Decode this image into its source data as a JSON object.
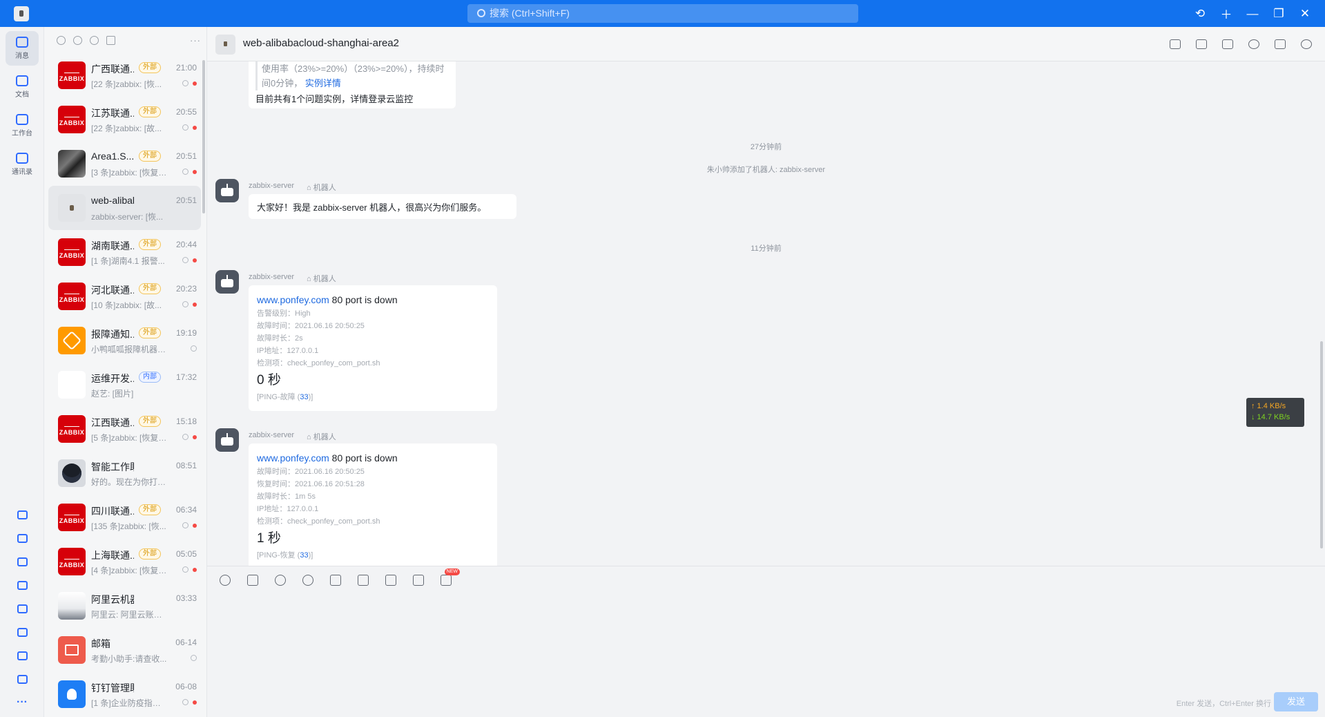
{
  "topbar": {
    "search_placeholder": "搜索 (Ctrl+Shift+F)"
  },
  "rail": {
    "items": [
      {
        "label": "消息",
        "icon": "chat-icon"
      },
      {
        "label": "文档",
        "icon": "doc-icon"
      },
      {
        "label": "工作台",
        "icon": "apps-icon"
      },
      {
        "label": "通讯录",
        "icon": "contacts-icon"
      }
    ]
  },
  "list": {
    "conversations": [
      {
        "name": "广西联通...",
        "tag": "外部",
        "time": "21:00",
        "preview": "[22 条]zabbix: [恢...",
        "avatar": "zabbix"
      },
      {
        "name": "江苏联通...",
        "tag": "外部",
        "time": "20:55",
        "preview": "[22 条]zabbix: [故...",
        "avatar": "zabbix"
      },
      {
        "name": "Area1.S...",
        "tag": "外部",
        "time": "20:51",
        "preview": "[3 条]zabbix: [恢复]...",
        "avatar": "photo"
      },
      {
        "name": "web-alibaba...",
        "tag": "",
        "time": "20:51",
        "preview": "zabbix-server: [恢...",
        "avatar": "light"
      },
      {
        "name": "湖南联通...",
        "tag": "外部",
        "time": "20:44",
        "preview": "[1 条]湖南4.1 报警...",
        "avatar": "zabbix"
      },
      {
        "name": "河北联通...",
        "tag": "外部",
        "time": "20:23",
        "preview": "[10 条]zabbix: [故...",
        "avatar": "zabbix"
      },
      {
        "name": "报障通知...",
        "tag": "外部",
        "time": "19:19",
        "preview": "小鸭呱呱报障机器人...",
        "avatar": "orange"
      },
      {
        "name": "运维开发...",
        "tag": "内部",
        "time": "17:32",
        "preview": "赵艺: [图片]",
        "avatar": "grid"
      },
      {
        "name": "江西联通...",
        "tag": "外部",
        "time": "15:18",
        "preview": "[5 条]zabbix: [恢复]...",
        "avatar": "zabbix"
      },
      {
        "name": "智能工作助理",
        "tag": "",
        "time": "08:51",
        "preview": "好的。现在为你打开...",
        "avatar": "bot"
      },
      {
        "name": "四川联通...",
        "tag": "外部",
        "time": "06:34",
        "preview": "[135 条]zabbix: [恢...",
        "avatar": "zabbix"
      },
      {
        "name": "上海联通...",
        "tag": "外部",
        "time": "05:05",
        "preview": "[4 条]zabbix: [恢复]...",
        "avatar": "zabbix"
      },
      {
        "name": "阿里云机器人...",
        "tag": "",
        "time": "03:33",
        "preview": "阿里云: 阿里云账户...",
        "avatar": "cloud"
      },
      {
        "name": "邮箱",
        "tag": "",
        "time": "06-14",
        "preview": "考勤小助手:请查收...",
        "avatar": "mail"
      },
      {
        "name": "钉钉管理助手",
        "tag": "",
        "time": "06-08",
        "preview": "[1 条]企业防疫指南...",
        "avatar": "blue"
      }
    ]
  },
  "chat": {
    "title": "web-alibabacloud-shanghai-area2",
    "msg0": {
      "line1": "使用率（23%>=20%）（23%>=20%），持续时",
      "line2": "间0分钟，",
      "link": "实例详情",
      "footer": "目前共有1个问题实例，详情登录云监控"
    },
    "time1": "27分钟前",
    "system_note": "朱小帅添加了机器人: zabbix-server",
    "sender": "zabbix-server",
    "robot_label": "机器人",
    "msg1": "大家好！我是 zabbix-server 机器人，很高兴为你们服务。",
    "time2": "11分钟前",
    "msg2": {
      "link": "www.ponfey.com",
      "title_rest": " 80 port is down",
      "lines": [
        "告警级别：High",
        "故障时间：2021.06.16 20:50:25",
        "故障时长：2s",
        "IP地址：127.0.0.1",
        "检测项：check_ponfey_com_port.sh"
      ],
      "big": "0 秒",
      "ping_label": "[PING-故障 (",
      "ping_num": "33",
      "ping_end": ")]"
    },
    "msg3": {
      "link": "www.ponfey.com",
      "title_rest": " 80 port is down",
      "lines": [
        "故障时间：2021.06.16 20:50:25",
        "恢复时间：2021.06.16 20:51:28",
        "故障时长：1m 5s",
        "IP地址：127.0.0.1",
        "检测项：check_ponfey_com_port.sh"
      ],
      "big": "1 秒",
      "ping_label": "[PING-恢复 (",
      "ping_num": "33",
      "ping_end": ")]"
    }
  },
  "netspeed": {
    "up": "↑ 1.4 KB/s",
    "down": "↓ 14.7 KB/s"
  },
  "composer": {
    "new_badge": "NEW",
    "hint": "Enter 发送，Ctrl+Enter 换行",
    "send": "发送"
  }
}
